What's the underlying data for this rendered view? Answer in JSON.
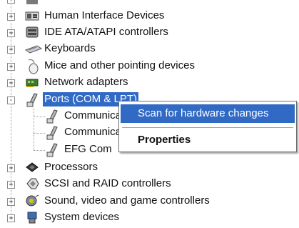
{
  "tree": {
    "partial_top_label": "...",
    "items": [
      {
        "label": "Human Interface Devices",
        "expander": "+",
        "icon": "hid-icon"
      },
      {
        "label": "IDE ATA/ATAPI controllers",
        "expander": "+",
        "icon": "ide-controller-icon"
      },
      {
        "label": "Keyboards",
        "expander": "+",
        "icon": "keyboard-icon"
      },
      {
        "label": "Mice and other pointing devices",
        "expander": "+",
        "icon": "mouse-icon"
      },
      {
        "label": "Network adapters",
        "expander": "+",
        "icon": "network-adapter-icon"
      },
      {
        "label": "Ports (COM & LPT)",
        "expander": "-",
        "icon": "port-icon",
        "selected": true
      },
      {
        "label": "Communica",
        "child": true,
        "icon": "port-icon"
      },
      {
        "label": "Communica",
        "child": true,
        "icon": "port-icon"
      },
      {
        "label": "EFG Com",
        "child": true,
        "icon": "port-icon"
      },
      {
        "label": "Processors",
        "expander": "+",
        "icon": "processor-icon"
      },
      {
        "label": "SCSI and RAID controllers",
        "expander": "+",
        "icon": "scsi-controller-icon"
      },
      {
        "label": "Sound, video and game controllers",
        "expander": "+",
        "icon": "sound-icon"
      },
      {
        "label": "System devices",
        "expander": "+",
        "icon": "system-devices-icon"
      }
    ]
  },
  "context_menu": {
    "scan_label": "Scan for hardware changes",
    "properties_label": "Properties"
  },
  "colors": {
    "selection": "#316ac5",
    "connector": "#9a9a9a"
  }
}
